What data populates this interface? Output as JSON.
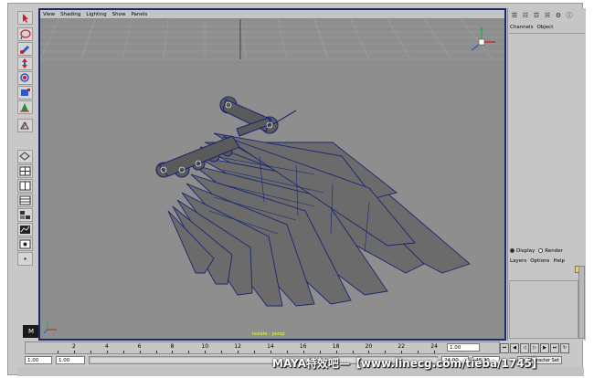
{
  "viewport": {
    "menu": [
      "View",
      "Shading",
      "Lighting",
      "Show",
      "Panels"
    ],
    "camera_label": "Isolate : persp"
  },
  "channel_box": {
    "tabs": [
      "Channels",
      "Object"
    ],
    "display_options": [
      {
        "label": "Display",
        "selected": true
      },
      {
        "label": "Render",
        "selected": false
      }
    ],
    "layer_menu": [
      "Layers",
      "Options",
      "Help"
    ]
  },
  "timeline": {
    "ticks": [
      "2",
      "4",
      "6",
      "8",
      "10",
      "12",
      "14",
      "16",
      "18",
      "20",
      "22",
      "24"
    ],
    "current_frame": "1.00"
  },
  "range": {
    "start": "1.00",
    "playback_start": "1.00",
    "playback_end": "24.00",
    "end": "48.00",
    "character_set": "No Character Set"
  },
  "watermark": "MAYA特效吧—【www.linecg.com/tieba/1745】",
  "colors": {
    "viewport_bg": "#8e8e8e",
    "wireframe": "#1a2673",
    "mesh_fill": "#6b6b6b",
    "frame_border": "#1c2a6a"
  },
  "icons": [
    "select-tool-icon",
    "lasso-tool-icon",
    "paint-tool-icon",
    "move-tool-icon",
    "rotate-tool-icon",
    "scale-tool-icon",
    "manipulator-tool-icon",
    "layout-single-icon",
    "layout-four-icon",
    "layout-two-icon",
    "outliner-icon",
    "hypershade-icon",
    "graph-editor-icon"
  ]
}
